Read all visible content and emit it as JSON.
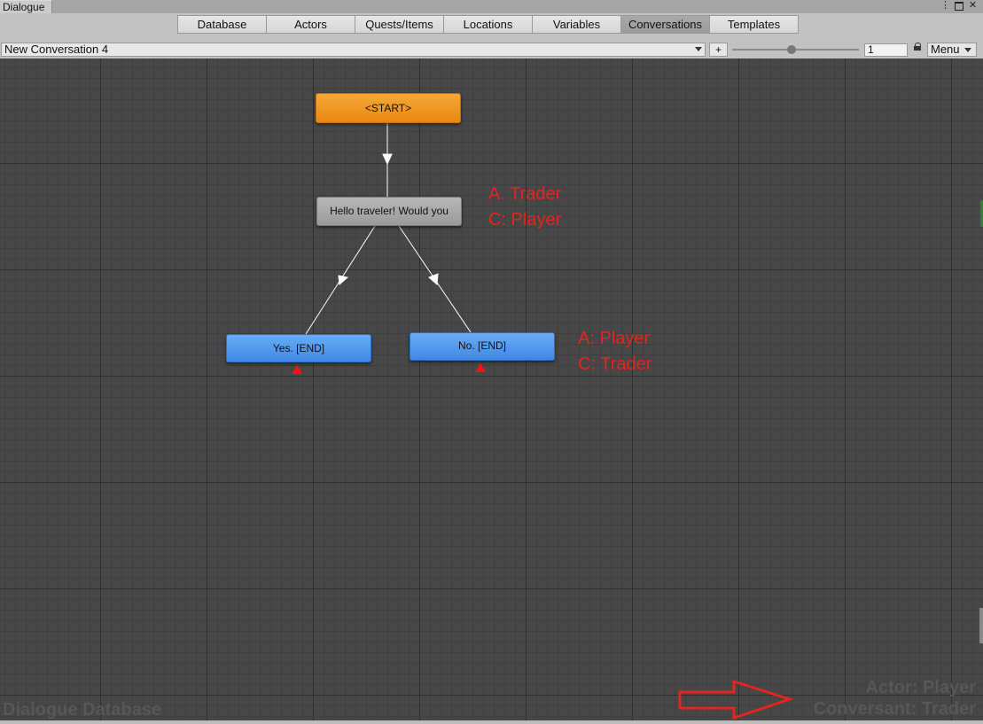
{
  "window": {
    "tab_title": "Dialogue",
    "icons": [
      "more-vert-icon",
      "maximize-icon",
      "close-icon"
    ]
  },
  "tabs": [
    {
      "label": "Database",
      "active": false
    },
    {
      "label": "Actors",
      "active": false
    },
    {
      "label": "Quests/Items",
      "active": false
    },
    {
      "label": "Locations",
      "active": false
    },
    {
      "label": "Variables",
      "active": false
    },
    {
      "label": "Conversations",
      "active": true
    },
    {
      "label": "Templates",
      "active": false
    }
  ],
  "toolbar": {
    "conversation_selected": "New Conversation 4",
    "add_label": "+",
    "zoom_level": 0.47,
    "zoom_field_value": "1",
    "menu_label": "Menu"
  },
  "canvas": {
    "nodes": {
      "start": "<START>",
      "npc_line": "Hello traveler! Would you",
      "yes": "Yes. [END]",
      "no": "No. [END]"
    },
    "annotations": {
      "npc": [
        "A. Trader",
        "C: Player"
      ],
      "responses": [
        "A: Player",
        "C: Trader"
      ]
    },
    "watermark_left": "Dialogue Database",
    "watermark_actor": "Actor: Player",
    "watermark_conversant": "Conversant: Trader",
    "colors": {
      "start_node": "#f09a26",
      "npc_node": "#a8a8a8",
      "player_node": "#4f96ec",
      "annotation": "#e3241f"
    }
  }
}
